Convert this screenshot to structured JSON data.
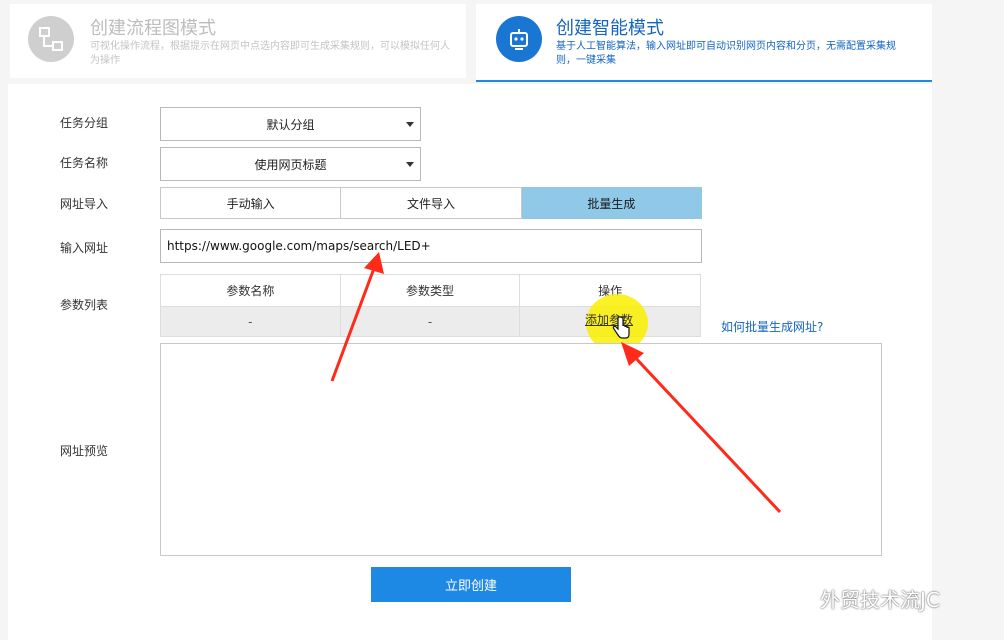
{
  "modes": {
    "flow": {
      "title": "创建流程图模式",
      "desc": "可视化操作流程，根据提示在网页中点选内容即可生成采集规则，可以模拟任何人为操作"
    },
    "smart": {
      "title": "创建智能模式",
      "desc": "基于人工智能算法，输入网址即可自动识别网页内容和分页，无需配置采集规则，一键采集"
    }
  },
  "form": {
    "group_label": "任务分组",
    "group_value": "默认分组",
    "name_label": "任务名称",
    "name_value": "使用网页标题",
    "import_label": "网址导入",
    "import_tabs": [
      "手动输入",
      "文件导入",
      "批量生成"
    ],
    "active_import_tab": "批量生成",
    "url_label": "输入网址",
    "url_value": "https://www.google.com/maps/search/LED+",
    "params_label": "参数列表",
    "params_headers": [
      "参数名称",
      "参数类型",
      "操作"
    ],
    "params_row": [
      "-",
      "-"
    ],
    "add_param": "添加参数",
    "help_link": "如何批量生成网址?",
    "preview_label": "网址预览",
    "create_button": "立即创建"
  },
  "watermark": "外贸技术流JC",
  "colors": {
    "accent": "#1e88e5",
    "active_tab": "#90c8e8",
    "highlight": "#faf000",
    "arrow": "#ff2a1a"
  }
}
